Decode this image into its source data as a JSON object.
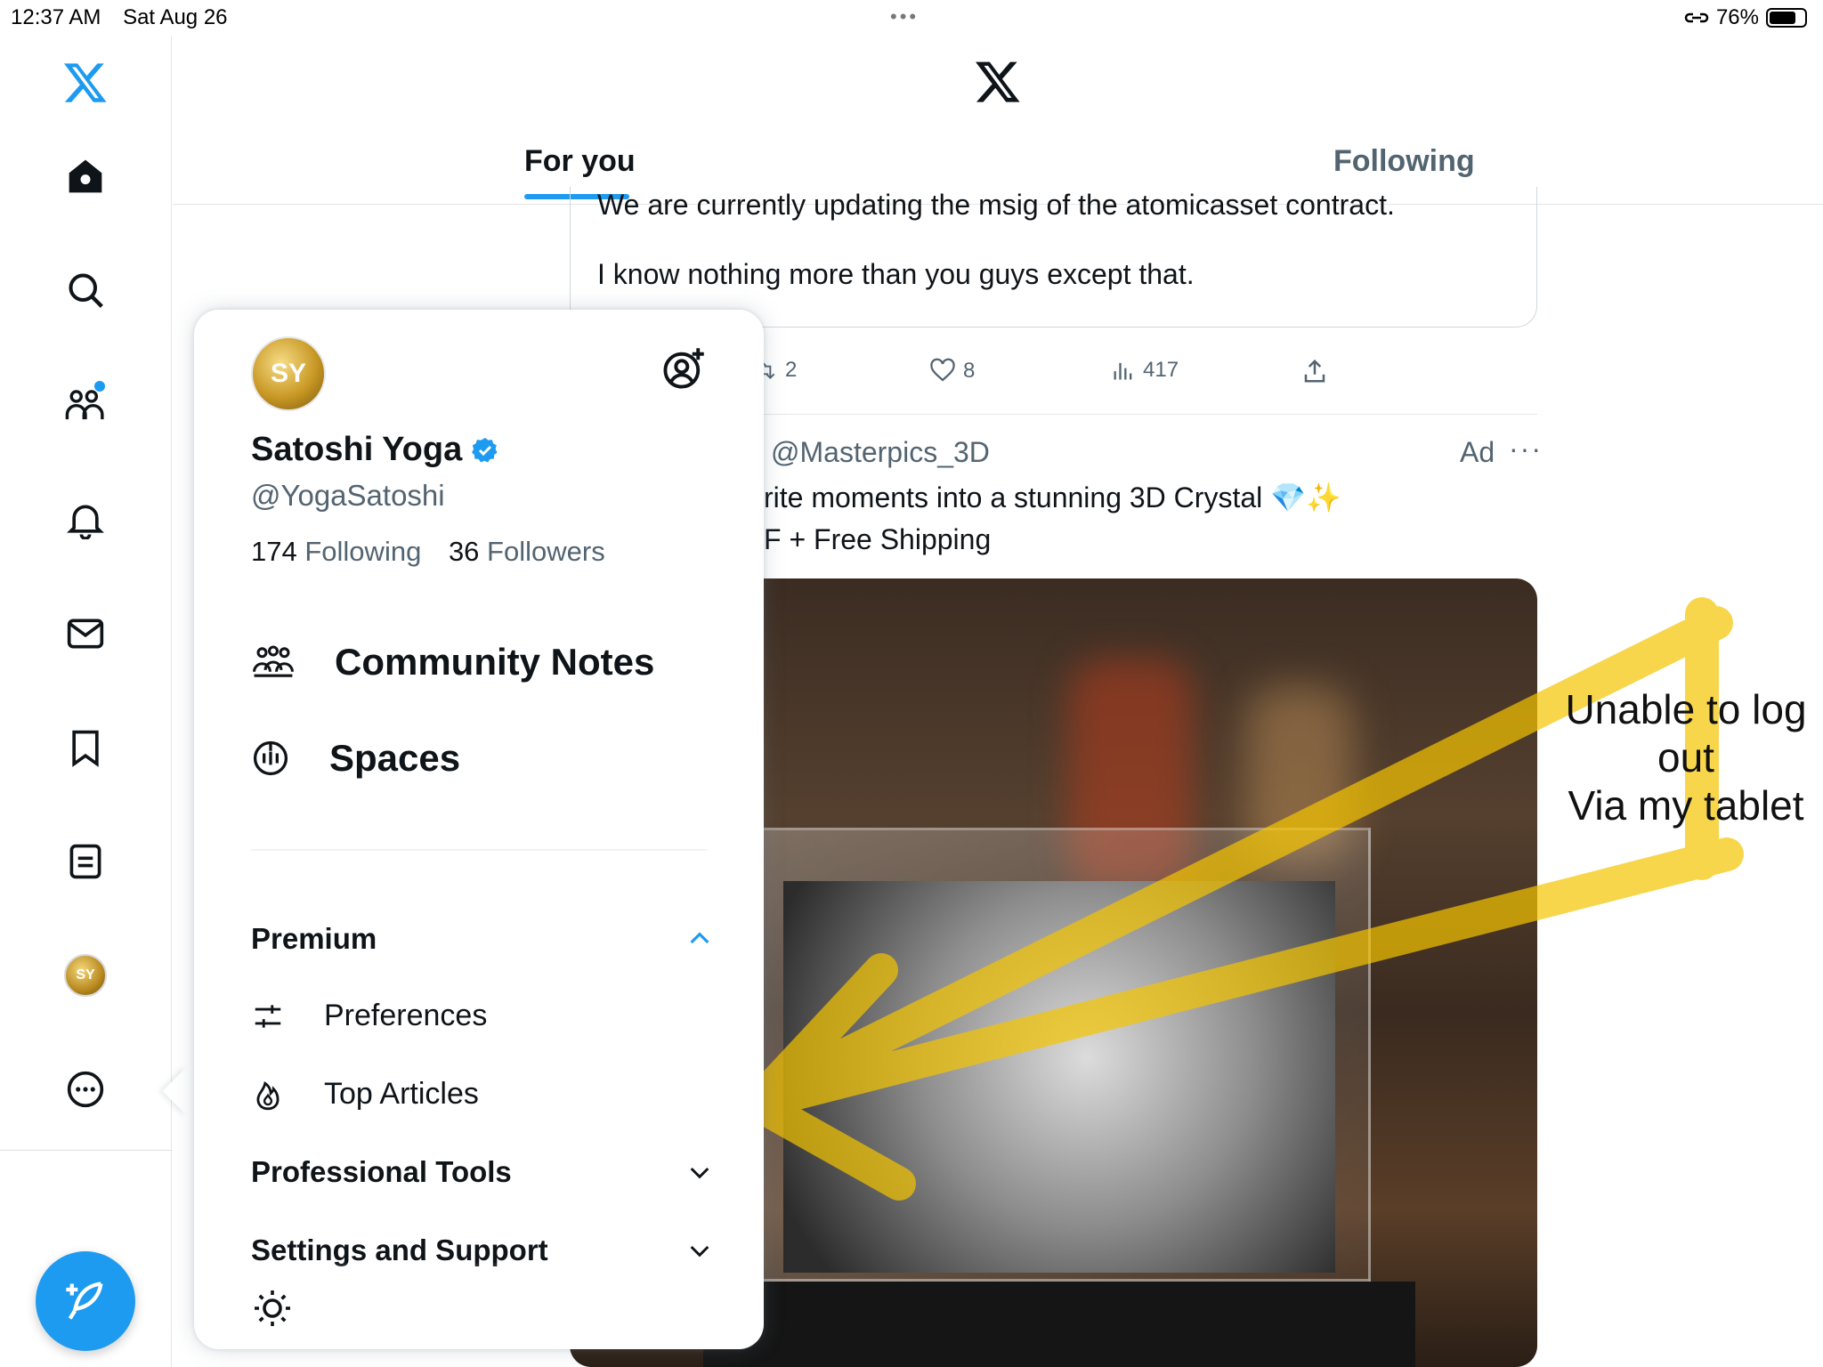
{
  "status_bar": {
    "time": "12:37 AM",
    "date": "Sat Aug 26",
    "battery": "76%",
    "battery_level": 0.76
  },
  "rail": {
    "icons": [
      "x-logo-icon",
      "home-icon",
      "search-icon",
      "communities-icon",
      "notifications-icon",
      "messages-icon",
      "bookmarks-icon",
      "lists-icon",
      "profile-avatar",
      "more-icon"
    ],
    "compose_icon": "compose-feather-icon",
    "accent": "#1d9bf0"
  },
  "header": {
    "tabs": [
      {
        "label": "For you",
        "active": true
      },
      {
        "label": "Following",
        "active": false
      }
    ]
  },
  "feed": {
    "quoted_text_line1": "We are currently updating the msig of the atomicasset contract.",
    "quoted_text_line2": "I know nothing more than you guys except that.",
    "actions": {
      "retweets": "2",
      "likes": "8",
      "views": "417"
    },
    "ad": {
      "handle": "@Masterpics_3D",
      "label": "Ad",
      "text_line1": "rite moments into a stunning 3D Crystal 💎✨",
      "text_line2": "F + Free Shipping"
    }
  },
  "annotation": {
    "line1": "Unable to log",
    "line2": "out",
    "line3": "Via my tablet",
    "highlight_color": "#f5c400"
  },
  "menu": {
    "avatar_initials": "SY",
    "name": "Satoshi Yoga",
    "handle": "@YogaSatoshi",
    "following_count": "174",
    "following_label": "Following",
    "followers_count": "36",
    "followers_label": "Followers",
    "items": [
      {
        "label": "Community Notes",
        "icon": "community-notes-icon"
      },
      {
        "label": "Spaces",
        "icon": "spaces-icon"
      }
    ],
    "premium": {
      "label": "Premium",
      "expanded": true,
      "sub_items": [
        {
          "label": "Preferences",
          "icon": "sliders-icon"
        },
        {
          "label": "Top Articles",
          "icon": "flame-icon"
        }
      ]
    },
    "professional_tools": "Professional Tools",
    "settings_support": "Settings and Support",
    "theme_icon": "sun-icon"
  }
}
